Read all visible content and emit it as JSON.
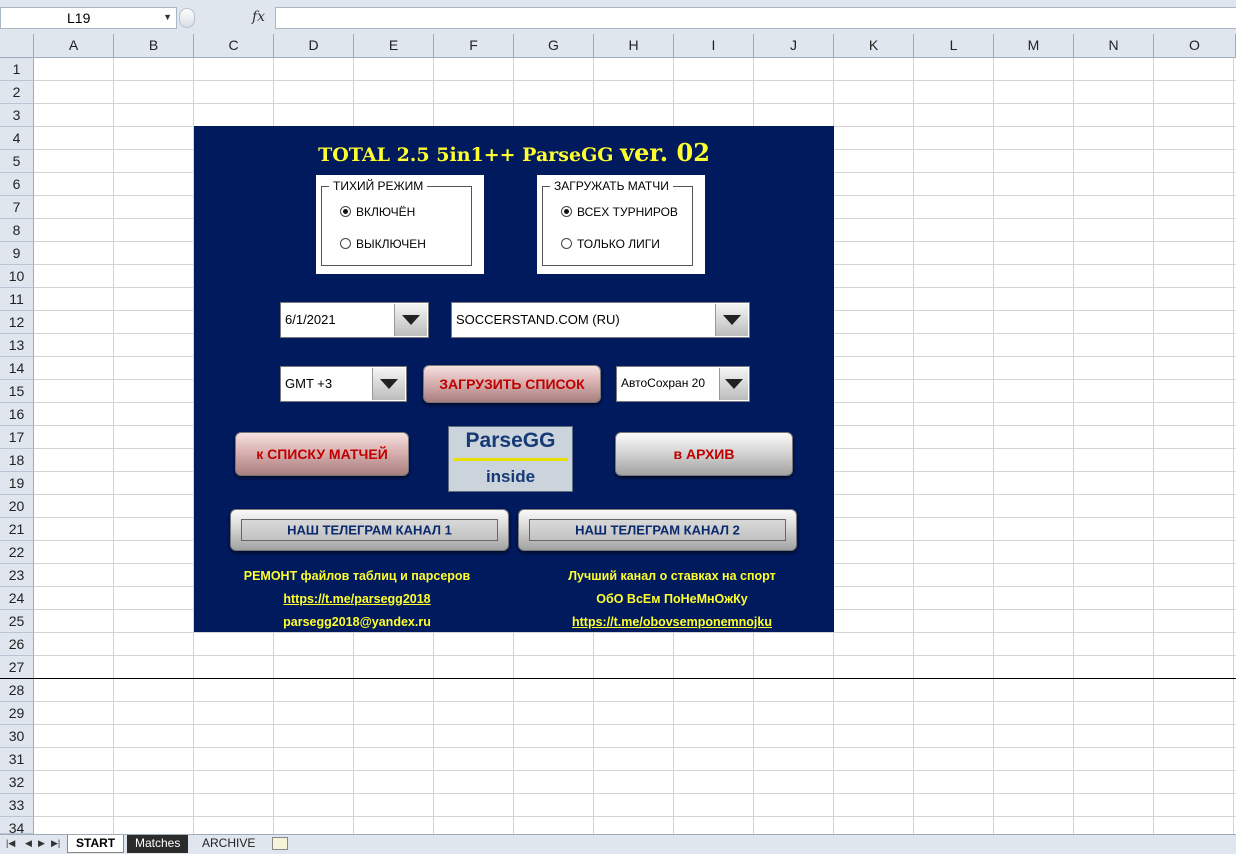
{
  "formula_bar": {
    "name_box": "L19",
    "fx": "fx",
    "formula": ""
  },
  "columns": [
    "A",
    "B",
    "C",
    "D",
    "E",
    "F",
    "G",
    "H",
    "I",
    "J",
    "K",
    "L",
    "M",
    "N",
    "O"
  ],
  "rows": [
    "1",
    "2",
    "3",
    "4",
    "5",
    "6",
    "7",
    "8",
    "9",
    "10",
    "11",
    "12",
    "13",
    "14",
    "15",
    "16",
    "17",
    "18",
    "19",
    "20",
    "21",
    "22",
    "23",
    "24",
    "25",
    "26",
    "27",
    "28",
    "29",
    "30",
    "31",
    "32",
    "33",
    "34"
  ],
  "panel": {
    "title_small": "TOTAL 2.5 5in1++ ParseGG",
    "title_big": "ver. 02",
    "quiet_mode": {
      "legend": "ТИХИЙ РЕЖИМ",
      "options": [
        "ВКЛЮЧЁН",
        "ВЫКЛЮЧЕН"
      ],
      "selected": 0
    },
    "load_matches": {
      "legend": "ЗАГРУЖАТЬ МАТЧИ",
      "options": [
        "ВСЕХ ТУРНИРОВ",
        "ТОЛЬКО ЛИГИ"
      ],
      "selected": 0
    },
    "date_combo": "6/1/2021",
    "source_combo": "SOCCERSTAND.COM (RU)",
    "gmt_combo": "GMT +3",
    "autosave_combo": "АвтоСохран 20",
    "load_list_button": "ЗАГРУЗИТЬ СПИСОК",
    "to_matches_button": "к СПИСКУ МАТЧЕЙ",
    "to_archive_button": "в АРХИВ",
    "logo_top": "ParseGG",
    "logo_bottom": "inside",
    "telegram_1": "НАШ ТЕЛЕГРАМ  КАНАЛ 1",
    "telegram_2": "НАШ ТЕЛЕГРАМ  КАНАЛ 2",
    "left_info": [
      "РЕМОНТ  файлов таблиц и парсеров",
      "https://t.me/parsegg2018",
      "parsegg2018@yandex.ru"
    ],
    "right_info": [
      "Лучший канал о ставках на спорт",
      "ОбО ВсЕм ПоНеМнОжКу",
      "https://t.me/obovsemponemnojku"
    ],
    "accent_color": "#001a5e",
    "text_color": "#ffff2e"
  },
  "sheet_tabs": [
    "START",
    "Matches",
    "ARCHIVE"
  ],
  "icons": {
    "nav": [
      "first-sheet-icon",
      "prev-sheet-icon",
      "next-sheet-icon",
      "last-sheet-icon"
    ],
    "new_sheet": "new-sheet-icon"
  }
}
